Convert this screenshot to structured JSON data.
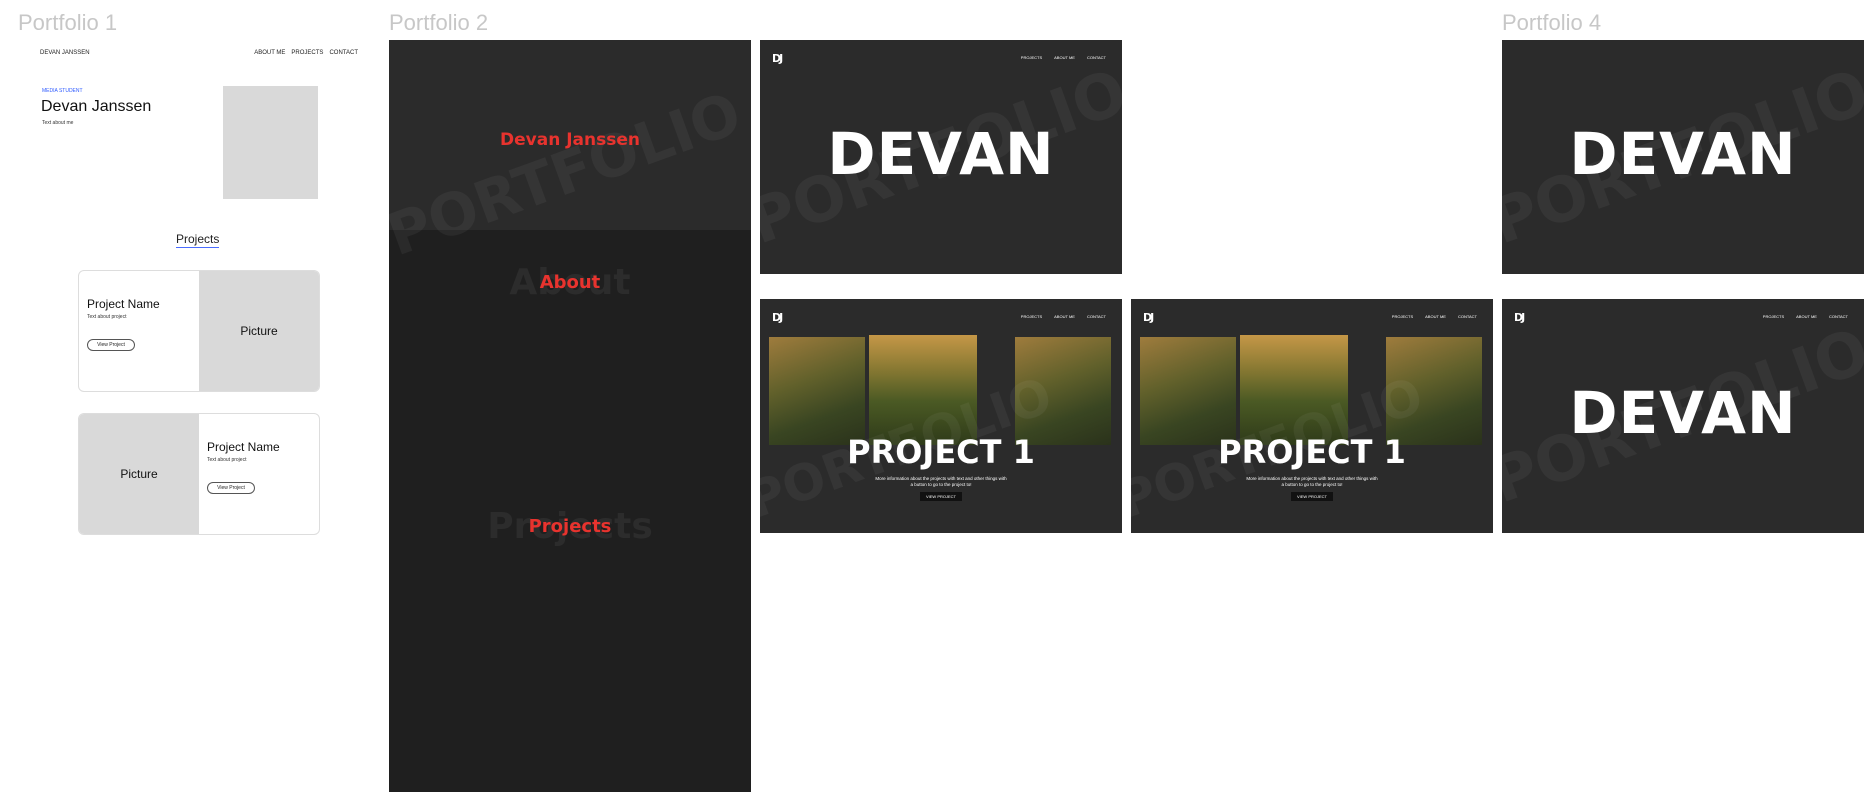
{
  "frames": {
    "p1_label": "Portfolio 1",
    "p2_label": "Portfolio 2",
    "p4_label": "Portfolio 4"
  },
  "p1": {
    "brand": "DEVAN JANSSEN",
    "nav": [
      "ABOUT ME",
      "PROJECTS",
      "CONTACT"
    ],
    "kicker": "MEDIA STUDENT",
    "name": "Devan Janssen",
    "about": "Text about me",
    "projects_heading": "Projects",
    "cards": [
      {
        "name": "Project Name",
        "text": "Text about project",
        "button": "View Project",
        "picture": "Picture"
      },
      {
        "name": "Project Name",
        "text": "Text about project",
        "button": "View Project",
        "picture": "Picture"
      }
    ]
  },
  "p2": {
    "watermark": "PORTFOLIO",
    "name": "Devan Janssen",
    "about": "About",
    "projects": "Projects"
  },
  "hero": {
    "logo": "DJ",
    "nav": [
      "PROJECTS",
      "ABOUT ME",
      "CONTACT"
    ],
    "title": "DEVAN",
    "watermark": "PORTFOLIO"
  },
  "project": {
    "title": "PROJECT 1",
    "desc_line1": "More information about the projects with text and other things with",
    "desc_line2": "a button to go to the project to!",
    "button": "VIEW PROJECT"
  },
  "colors": {
    "accent_red": "#e8332e",
    "dark_bg": "#2b2b2b",
    "darker_bg": "#1f1f1f",
    "wire_gray": "#d9d9d9",
    "link_blue": "#2f5bff"
  }
}
